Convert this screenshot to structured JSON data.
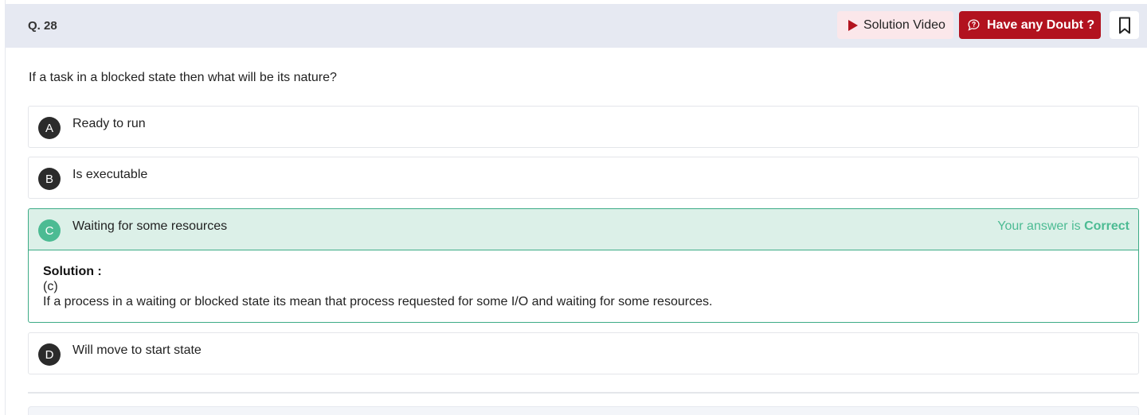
{
  "question": {
    "number": "Q. 28",
    "text": "If a task in a blocked state then what will be its nature?"
  },
  "toolbar": {
    "solution_video_label": "Solution Video",
    "doubt_label": "Have any Doubt ?"
  },
  "options": [
    {
      "letter": "A",
      "text": "Ready to run"
    },
    {
      "letter": "B",
      "text": "Is executable"
    },
    {
      "letter": "C",
      "text": "Waiting for some resources"
    },
    {
      "letter": "D",
      "text": "Will move to start state"
    }
  ],
  "result": {
    "prefix": "Your answer is",
    "status": "Correct"
  },
  "solution": {
    "title": "Solution :",
    "answer": "(c)",
    "explanation": "If a process in a waiting or blocked state its mean that process requested for some I/O and waiting for some resources."
  },
  "colors": {
    "brand_red": "#b2121f",
    "correct_green": "#4cbb93",
    "correct_bg": "#dcf0e8",
    "header_bg": "#e6e9f2"
  },
  "icons": {
    "video": "play-icon",
    "doubt": "question-bubble-icon",
    "bookmark": "bookmark-icon"
  }
}
